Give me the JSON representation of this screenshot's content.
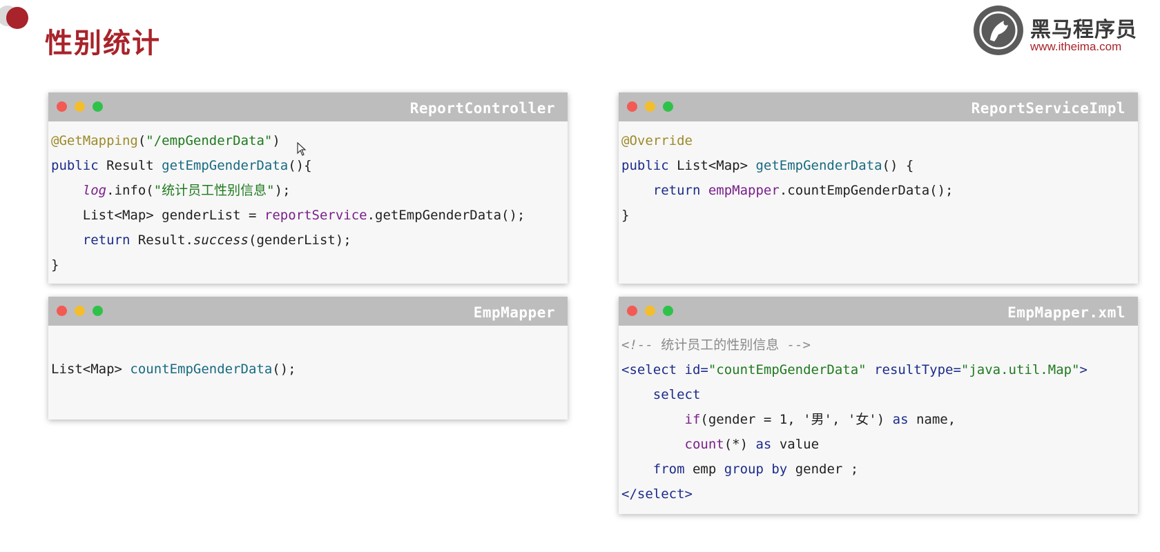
{
  "page": {
    "title": "性别统计"
  },
  "logo": {
    "name": "黑马程序员",
    "url": "www.itheima.com"
  },
  "panels": {
    "report_controller": {
      "title": "ReportController",
      "l1": {
        "ann": "@GetMapping",
        "a": "(",
        "str": "\"/empGenderData\"",
        "b": ")"
      },
      "l2": {
        "kw": "public",
        "a": " Result ",
        "fn": "getEmpGenderData",
        "b": "(){"
      },
      "l3": {
        "indent": "    ",
        "fld": "log",
        "a": ".info(",
        "str": "\"统计员工性别信息\"",
        "b": ");"
      },
      "l4": {
        "indent": "    ",
        "a": "List<Map> genderList = ",
        "fld": "reportService",
        "b": ".getEmpGenderData();"
      },
      "l5": {
        "indent": "    ",
        "kw": "return",
        "a": " Result.",
        "it": "success",
        "b": "(genderList);"
      },
      "l6": {
        "a": "}"
      }
    },
    "report_service_impl": {
      "title": "ReportServiceImpl",
      "l1": {
        "ann": "@Override"
      },
      "l2": {
        "kw": "public",
        "a": " List<Map> ",
        "fn": "getEmpGenderData",
        "b": "() {"
      },
      "l3": {
        "indent": "    ",
        "kw": "return",
        "a": " ",
        "fld": "empMapper",
        "b": ".countEmpGenderData();"
      },
      "l4": {
        "a": "}"
      }
    },
    "emp_mapper": {
      "title": "EmpMapper",
      "l1": {
        "a": "List<Map> ",
        "fn": "countEmpGenderData",
        "b": "();"
      }
    },
    "emp_mapper_xml": {
      "title": "EmpMapper.xml",
      "l1": {
        "c1": "<!-- ",
        "c2": "统计员工的性别信息",
        "c3": " -->"
      },
      "l2": {
        "t1": "<select ",
        "a1": "id=",
        "v1": "\"countEmpGenderData\"",
        "sp": " ",
        "a2": "resultType=",
        "v2": "\"java.util.Map\"",
        "t2": ">"
      },
      "l3": {
        "indent": "    ",
        "kw": "select"
      },
      "l4": {
        "indent": "        ",
        "f": "if",
        "a": "(gender = 1, '男', '女') ",
        "kw": "as",
        "b": " name,"
      },
      "l5": {
        "indent": "        ",
        "f": "count",
        "a": "(*) ",
        "kw": "as",
        "b": " value"
      },
      "l6": {
        "indent": "    ",
        "kw1": "from",
        "a": " emp ",
        "kw2": "group by",
        "b": " gender ;"
      },
      "l7": {
        "t": "</select>"
      }
    }
  },
  "colors": {
    "brand_red": "#a8232a",
    "panel_header": "#bdbdbd",
    "panel_body": "#f7f7f7"
  }
}
